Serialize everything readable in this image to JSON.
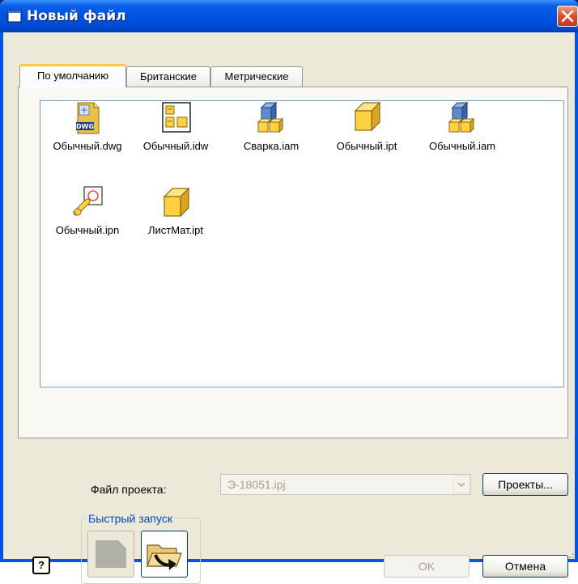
{
  "window": {
    "title": "Новый файл"
  },
  "tabs": [
    {
      "label": "По умолчанию",
      "active": true
    },
    {
      "label": "Британские",
      "active": false
    },
    {
      "label": "Метрические",
      "active": false
    }
  ],
  "files": [
    {
      "name": "Обычный.dwg",
      "icon": "dwg-file-icon"
    },
    {
      "name": "Обычный.idw",
      "icon": "drawing-sheet-icon"
    },
    {
      "name": "Сварка.iam",
      "icon": "weldment-assembly-icon"
    },
    {
      "name": "Обычный.ipt",
      "icon": "part-cube-icon"
    },
    {
      "name": "Обычный.iam",
      "icon": "assembly-icon"
    },
    {
      "name": "Обычный.ipn",
      "icon": "presentation-icon"
    },
    {
      "name": "ЛистМат.ipt",
      "icon": "sheet-metal-part-icon"
    }
  ],
  "dwg_badge": "DWG",
  "project": {
    "label": "Файл проекта:",
    "value": "Э-18051.ipj",
    "projects_button": "Проекты..."
  },
  "quick_launch": {
    "title": "Быстрый запуск"
  },
  "buttons": {
    "ok": "OK",
    "cancel": "Отмена",
    "help": "?"
  },
  "colors": {
    "titlebar": "#0054e3",
    "dialog_face": "#ece9d8",
    "tab_highlight": "#ffc83c",
    "group_title": "#0046d5",
    "icon_yellow": "#ffd040"
  }
}
